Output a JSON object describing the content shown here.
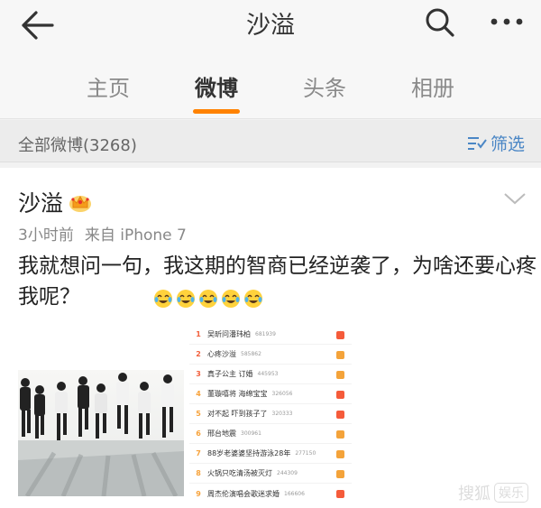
{
  "header": {
    "title": "沙溢",
    "back_icon": "arrow-left-icon",
    "search_icon": "search-icon",
    "more_icon": "more-dots-icon"
  },
  "tabs": [
    {
      "label": "主页",
      "active": false
    },
    {
      "label": "微博",
      "active": true
    },
    {
      "label": "头条",
      "active": false
    },
    {
      "label": "相册",
      "active": false
    }
  ],
  "filter_bar": {
    "count_label": "全部微博(3268)",
    "filter_label": "筛选",
    "filter_icon": "filter-icon"
  },
  "post": {
    "username": "沙溢",
    "badge_icon": "crown-vip-icon",
    "time": "3小时前",
    "source": "来自 iPhone 7",
    "text": "我就想问一句，我这期的智商已经逆袭了，为啥还要心疼我呢？",
    "emoji_icon": "laugh-cry-emoji-icon",
    "emoji_count": 5,
    "image_left": "group-photo",
    "hot_list": [
      {
        "rank": "1",
        "name": "吴昕问潘玮柏",
        "num": "681939"
      },
      {
        "rank": "2",
        "name": "心疼沙溢",
        "num": "585862"
      },
      {
        "rank": "3",
        "name": "真子公主 订婚",
        "num": "445953"
      },
      {
        "rank": "4",
        "name": "董璇嘻将 海绵宝宝",
        "num": "326056"
      },
      {
        "rank": "5",
        "name": "对不起 吓到孩子了",
        "num": "320333"
      },
      {
        "rank": "6",
        "name": "邢台地震",
        "num": "300961"
      },
      {
        "rank": "7",
        "name": "88岁老婆婆坚持游泳28年",
        "num": "277150"
      },
      {
        "rank": "8",
        "name": "火锅只吃清汤被灭灯",
        "num": "244309"
      },
      {
        "rank": "9",
        "name": "周杰伦演唱会歌迷求婚",
        "num": "166606"
      }
    ]
  },
  "watermark": {
    "text": "搜狐",
    "box_text": "娱乐"
  },
  "colors": {
    "accent": "#ff8200",
    "link": "#4a86c5"
  }
}
